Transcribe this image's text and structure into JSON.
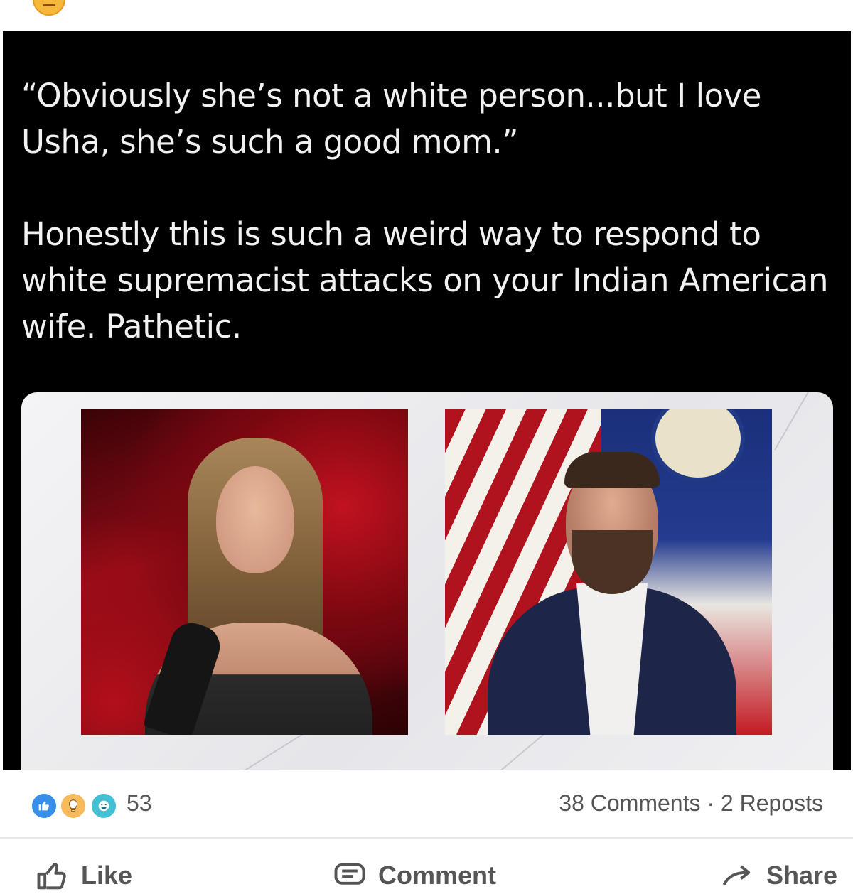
{
  "post": {
    "quote_line": "“Obviously she’s not a white person...but I love Usha, she’s such a good mom.”",
    "comment_line": "Honestly this is such a weird way to respond to white supremacist attacks on your Indian American wife. Pathetic."
  },
  "reactions": {
    "icons": [
      "like-icon",
      "insightful-icon",
      "funny-icon"
    ],
    "count": "53"
  },
  "stats": {
    "comments": "38 Comments",
    "separator": "·",
    "reposts": "2 Reposts"
  },
  "actions": {
    "like": "Like",
    "comment": "Comment",
    "share": "Share"
  },
  "colors": {
    "reaction_like": "#378fe9",
    "reaction_insight": "#f5bb5c",
    "reaction_funny": "#44bfd3",
    "media_background": "#000000"
  }
}
